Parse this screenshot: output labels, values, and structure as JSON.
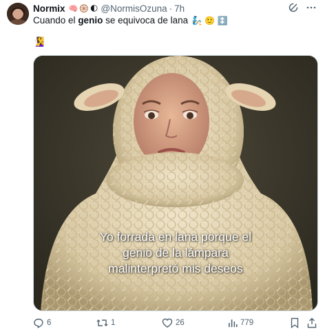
{
  "author": {
    "display_name": "Normix",
    "badges": [
      "🧠",
      "🛞",
      "🌓"
    ],
    "handle": "@NormisOzuna",
    "separator": "·",
    "time": "7h"
  },
  "tweet": {
    "text_before": "Cuando el ",
    "text_bold": "genio",
    "text_after": " se equivoca de lana",
    "text_emojis": "🧞 🙂 ↕️",
    "second_line_emoji": "🧏‍♀️"
  },
  "media": {
    "caption_line1": "Yo forrada en lana porque el",
    "caption_line2": "genio de la lámpara",
    "caption_line3": "malinterpretó mis deseos",
    "background_color": "#3e3a2e",
    "wool_color": "#e8dcc0"
  },
  "actions": {
    "replies": "6",
    "reposts": "1",
    "likes": "26",
    "views": "779"
  },
  "colors": {
    "text": "#0f1419",
    "muted": "#536471",
    "border": "#cfd9de"
  }
}
